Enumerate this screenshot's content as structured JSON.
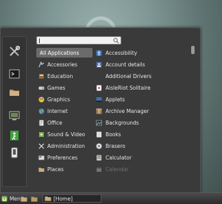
{
  "search": {
    "value": ""
  },
  "categories": [
    {
      "label": "All Applications",
      "icon": "none",
      "selected": true
    },
    {
      "label": "Accessories",
      "icon": "accessories-icon"
    },
    {
      "label": "Education",
      "icon": "education-icon"
    },
    {
      "label": "Games",
      "icon": "games-icon"
    },
    {
      "label": "Graphics",
      "icon": "graphics-icon"
    },
    {
      "label": "Internet",
      "icon": "internet-icon"
    },
    {
      "label": "Office",
      "icon": "office-icon"
    },
    {
      "label": "Sound & Video",
      "icon": "sound-video-icon"
    },
    {
      "label": "Administration",
      "icon": "administration-icon"
    },
    {
      "label": "Preferences",
      "icon": "preferences-icon"
    },
    {
      "label": "Places",
      "icon": "folder-icon"
    }
  ],
  "apps": [
    {
      "label": "Accessibility",
      "icon": "accessibility-icon"
    },
    {
      "label": "Account details",
      "icon": "account-icon"
    },
    {
      "label": "Additional Drivers",
      "icon": "none"
    },
    {
      "label": "AisleRiot Solitaire",
      "icon": "cards-icon"
    },
    {
      "label": "Applets",
      "icon": "applets-icon"
    },
    {
      "label": "Archive Manager",
      "icon": "archive-icon"
    },
    {
      "label": "Backgrounds",
      "icon": "backgrounds-icon"
    },
    {
      "label": "Books",
      "icon": "books-icon"
    },
    {
      "label": "Brasero",
      "icon": "disc-icon"
    },
    {
      "label": "Calculator",
      "icon": "calculator-icon"
    },
    {
      "label": "Calendar",
      "icon": "calendar-icon",
      "dim": true
    }
  ],
  "favorites": [
    "settings-tools-icon",
    "terminal-icon",
    "folder-icon",
    "display-lock-icon",
    "logout-icon",
    "shutdown-icon"
  ],
  "panel": {
    "menu_label": "Menu",
    "task_label": "[Home]"
  }
}
